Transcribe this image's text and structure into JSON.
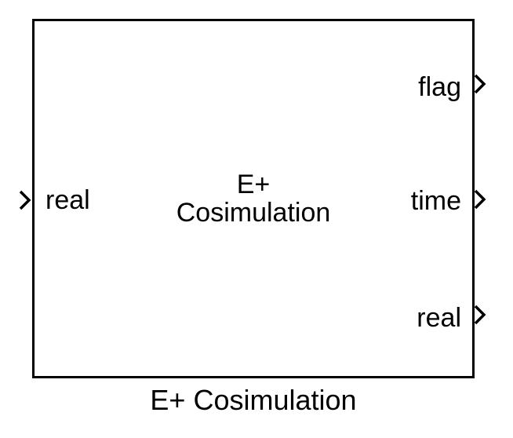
{
  "block": {
    "title_line1": "E+",
    "title_line2": "Cosimulation",
    "name": "E+ Cosimulation"
  },
  "inputs": [
    {
      "label": "real"
    }
  ],
  "outputs": [
    {
      "label": "flag"
    },
    {
      "label": "time"
    },
    {
      "label": "real"
    }
  ],
  "colors": {
    "stroke": "#000000",
    "background": "#ffffff"
  }
}
